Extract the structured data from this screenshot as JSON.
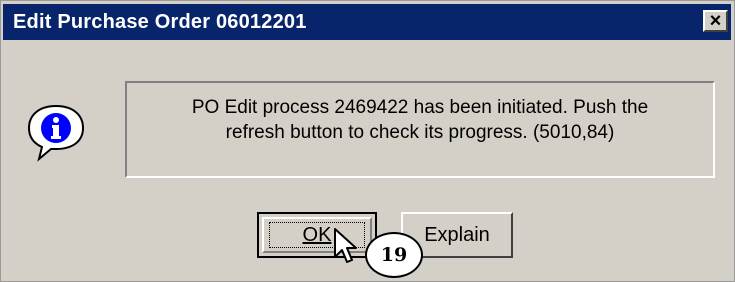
{
  "window": {
    "title": "Edit Purchase Order 06012201",
    "close_label": "×"
  },
  "message": {
    "icon": "info-icon",
    "line1": "PO Edit process 2469422 has been initiated.  Push the",
    "line2": "refresh button to check its progress. (5010,84)"
  },
  "buttons": {
    "ok_label": "OK",
    "explain_label": "Explain"
  },
  "annotation": {
    "step_number": "19"
  },
  "colors": {
    "titlebar": "#08246b",
    "dialog_bg": "#d4d0c8"
  }
}
